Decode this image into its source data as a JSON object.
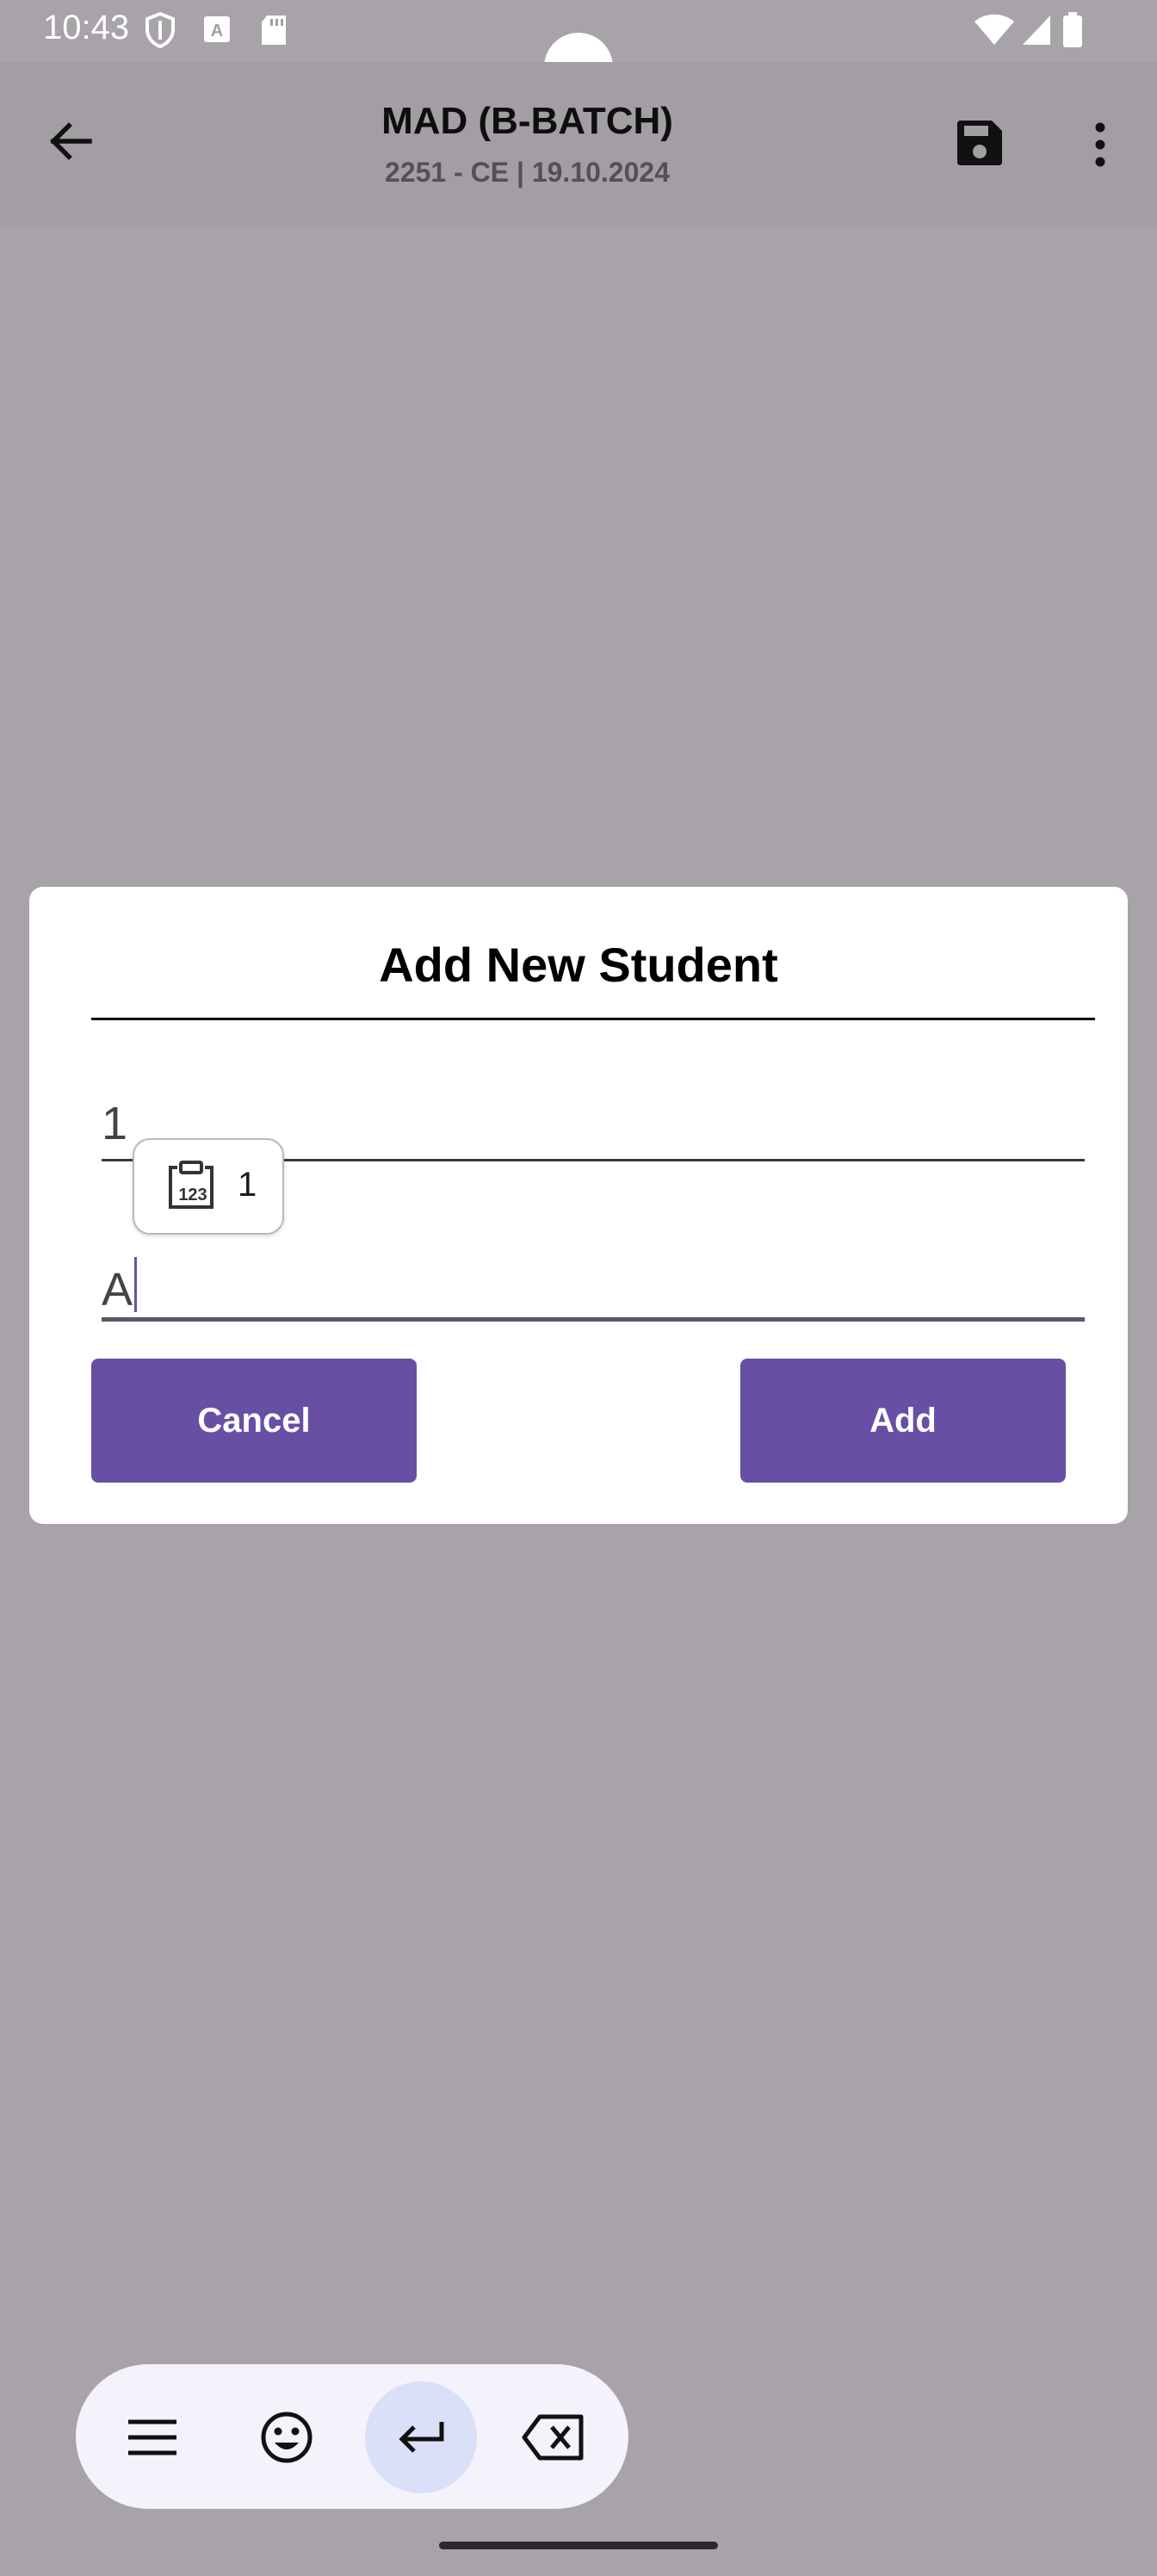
{
  "status_bar": {
    "time": "10:43",
    "icons": [
      "shield-icon",
      "text-a-icon",
      "sd-card-icon",
      "wifi-icon",
      "signal-icon",
      "battery-icon"
    ]
  },
  "app_bar": {
    "title": "MAD (B-BATCH)",
    "subtitle": "2251 - CE | 19.10.2024",
    "icons": [
      "back-arrow-icon",
      "save-icon",
      "more-vert-icon"
    ]
  },
  "dialog": {
    "title": "Add New Student",
    "field_roll": {
      "value": "1"
    },
    "field_name": {
      "value": "A"
    },
    "cancel_label": "Cancel",
    "add_label": "Add"
  },
  "clipboard_suggestion": {
    "text": "1",
    "icon": "clipboard-numbers-icon"
  },
  "keyboard_toolbar": {
    "icons": [
      "menu-icon",
      "emoji-icon",
      "enter-icon",
      "backspace-icon"
    ]
  },
  "colors": {
    "scrim_background": "#a7a3a8",
    "app_bar": "#a29ea3",
    "primary": "#6750a4",
    "keyboard_bar": "#f4f2fb",
    "enter_highlight": "#d9e0f8"
  }
}
